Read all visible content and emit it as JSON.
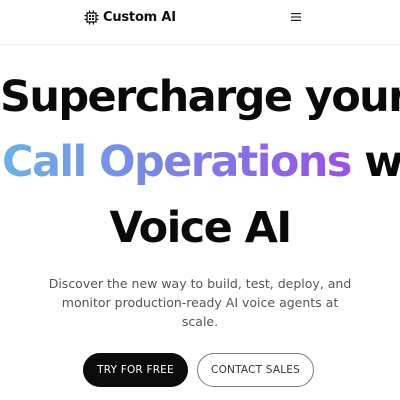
{
  "header": {
    "brand_name": "Custom AI",
    "logo_icon": "chip-grid-icon",
    "menu_icon": "hamburger-menu-icon"
  },
  "hero": {
    "headline_line1": "Supercharge your",
    "headline_gradient": "Call Operations",
    "headline_line2_rest": " with",
    "headline_line3": "Voice AI",
    "gradient_colors": [
      "#6ab1e9",
      "#7a86e7",
      "#9b4fe9"
    ],
    "subtitle_lines": [
      "Discover the new way to build, test, deploy, and",
      "monitor production-ready AI voice agents at",
      "scale."
    ]
  },
  "cta": {
    "primary_label": "TRY FOR FREE",
    "secondary_label": "CONTACT SALES"
  }
}
